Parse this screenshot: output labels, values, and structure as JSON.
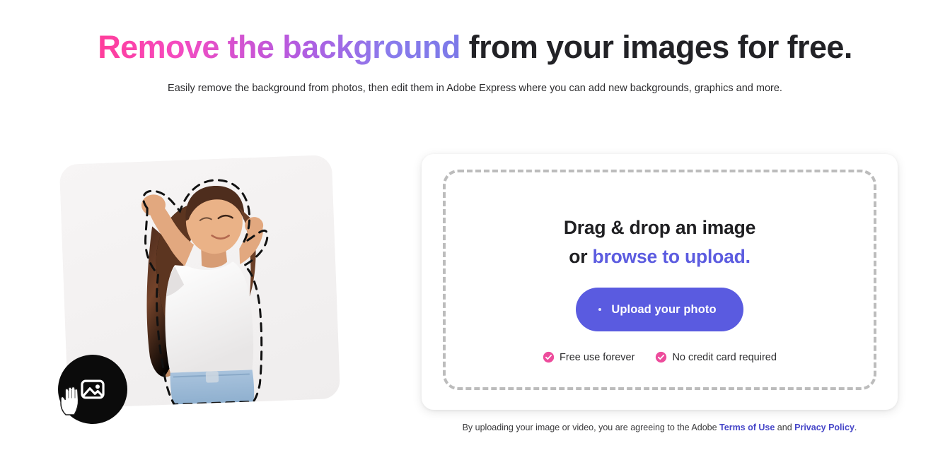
{
  "hero": {
    "heading_gradient": "Remove the background",
    "heading_rest": " from your images for free.",
    "subtitle": "Easily remove the background from photos, then edit them in Adobe Express where you can add new backgrounds, graphics and more."
  },
  "sample": {
    "badge_icon": "image-icon",
    "cursor_icon": "hand-cursor-icon",
    "alt": "Woman in white t-shirt with dashed cutout selection outline"
  },
  "upload": {
    "drop_title": "Drag & drop an image",
    "drop_or": "or ",
    "browse_link": "browse to upload.",
    "button_label": "Upload your photo",
    "features": [
      {
        "icon": "check-circle-icon",
        "label": "Free use forever"
      },
      {
        "icon": "check-circle-icon",
        "label": "No credit card required"
      }
    ]
  },
  "legal": {
    "prefix": "By uploading your image or video, you are agreeing to the Adobe ",
    "terms_link": "Terms of Use",
    "conjunction": " and ",
    "privacy_link": "Privacy Policy",
    "suffix": "."
  },
  "colors": {
    "gradient_start": "#FF3D9A",
    "gradient_end": "#7B79E8",
    "accent_purple": "#5C5CE0",
    "button_purple": "#5A5BE0",
    "check_pink": "#ED4C9C",
    "link_indigo": "#4646C8",
    "heading_dark": "#222226"
  }
}
